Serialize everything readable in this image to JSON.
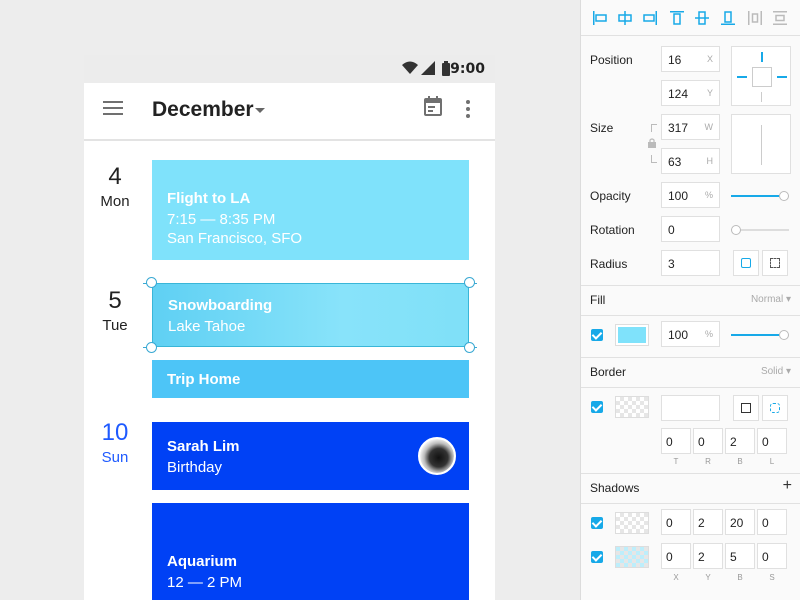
{
  "status": {
    "time": "9:00"
  },
  "appbar": {
    "title": "December"
  },
  "days": [
    {
      "num": "4",
      "dow": "Mon"
    },
    {
      "num": "5",
      "dow": "Tue"
    },
    {
      "num": "10",
      "dow": "Sun"
    }
  ],
  "events": {
    "flight": {
      "title": "Flight to LA",
      "time": "7:15 — 8:35 PM",
      "place": "San Francisco, SFO"
    },
    "snow": {
      "title": "Snowboarding",
      "place": "Lake Tahoe"
    },
    "trip": {
      "title": "Trip Home"
    },
    "sarah": {
      "title": "Sarah Lim",
      "sub": "Birthday"
    },
    "aqua": {
      "title": "Aquarium",
      "time": "12 — 2 PM"
    }
  },
  "inspector": {
    "position": {
      "label": "Position",
      "x": "16",
      "y": "124",
      "x_unit": "X",
      "y_unit": "Y"
    },
    "size": {
      "label": "Size",
      "w": "317",
      "h": "63",
      "w_unit": "W",
      "h_unit": "H"
    },
    "opacity": {
      "label": "Opacity",
      "value": "100",
      "unit": "%",
      "level": 1.0
    },
    "rotation": {
      "label": "Rotation",
      "value": "0",
      "level": 0.0
    },
    "radius": {
      "label": "Radius",
      "value": "3"
    },
    "fill": {
      "label": "Fill",
      "mode": "Normal",
      "opacity": "100",
      "unit": "%",
      "color": "#7fe2fb",
      "level": 1.0
    },
    "border": {
      "label": "Border",
      "mode": "Solid",
      "values": [
        "0",
        "0",
        "2",
        "0"
      ],
      "captions": [
        "T",
        "R",
        "B",
        "L"
      ]
    },
    "shadows": {
      "label": "Shadows",
      "add": "+",
      "rows": [
        {
          "values": [
            "0",
            "2",
            "20",
            "0"
          ]
        },
        {
          "values": [
            "0",
            "2",
            "5",
            "0"
          ]
        }
      ],
      "captions": [
        "X",
        "Y",
        "B",
        "S"
      ]
    }
  },
  "colors": {
    "accent": "#17a9e8",
    "event_light": "#7fe2fb",
    "event_dark": "#0041f5"
  }
}
